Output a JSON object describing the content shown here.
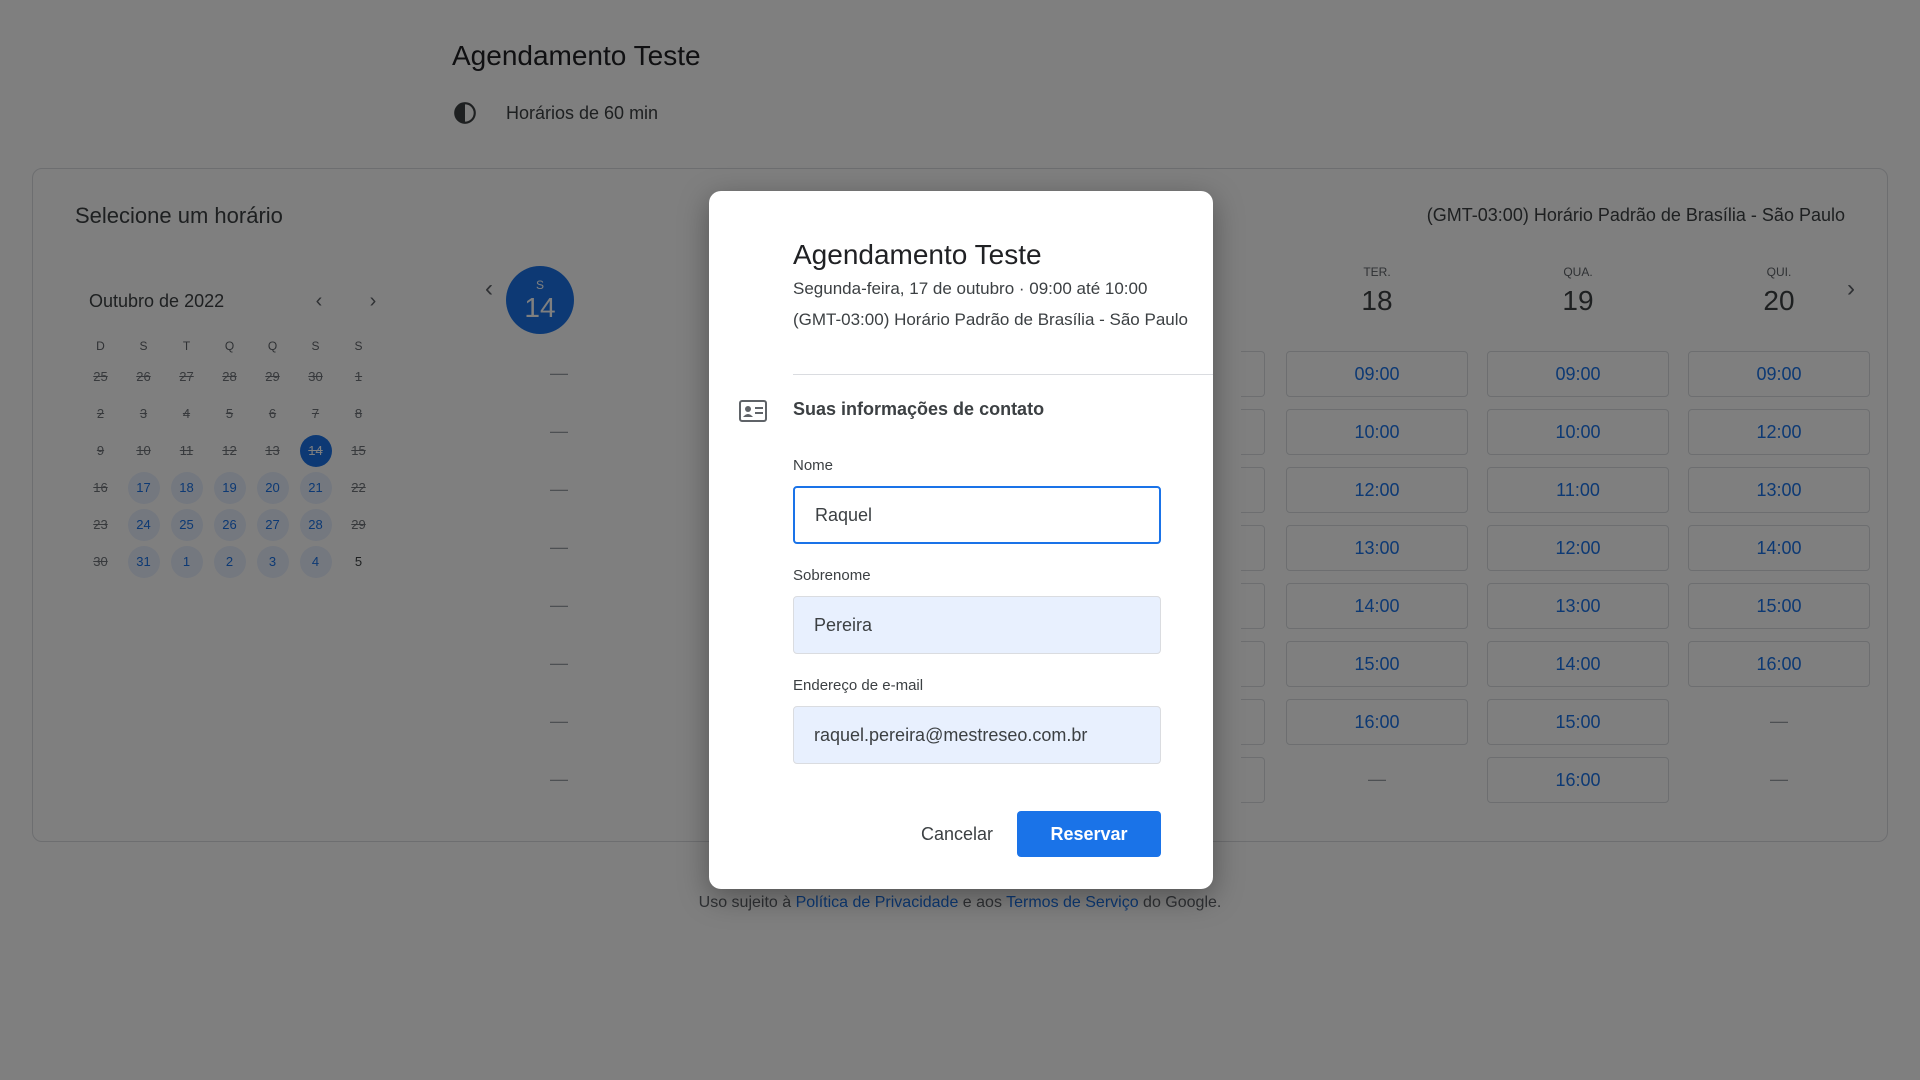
{
  "page": {
    "title": "Agendamento Teste",
    "duration": "Horários de 60 min",
    "section_title": "Selecione um horário",
    "timezone": "(GMT-03:00) Horário Padrão de Brasília - São Paulo"
  },
  "mini_calendar": {
    "month": "Outubro de 2022",
    "prev": "‹",
    "next": "›",
    "weekdays": [
      "D",
      "S",
      "T",
      "Q",
      "Q",
      "S",
      "S"
    ],
    "days": [
      {
        "n": "25",
        "s": "past"
      },
      {
        "n": "26",
        "s": "past"
      },
      {
        "n": "27",
        "s": "past"
      },
      {
        "n": "28",
        "s": "past"
      },
      {
        "n": "29",
        "s": "past"
      },
      {
        "n": "30",
        "s": "past"
      },
      {
        "n": "1",
        "s": "past"
      },
      {
        "n": "2",
        "s": "past"
      },
      {
        "n": "3",
        "s": "past"
      },
      {
        "n": "4",
        "s": "past"
      },
      {
        "n": "5",
        "s": "past"
      },
      {
        "n": "6",
        "s": "past"
      },
      {
        "n": "7",
        "s": "past"
      },
      {
        "n": "8",
        "s": "past"
      },
      {
        "n": "9",
        "s": "past"
      },
      {
        "n": "10",
        "s": "past"
      },
      {
        "n": "11",
        "s": "past"
      },
      {
        "n": "12",
        "s": "past"
      },
      {
        "n": "13",
        "s": "past"
      },
      {
        "n": "14",
        "s": "sel"
      },
      {
        "n": "15",
        "s": "past"
      },
      {
        "n": "16",
        "s": "past"
      },
      {
        "n": "17",
        "s": "avail"
      },
      {
        "n": "18",
        "s": "avail"
      },
      {
        "n": "19",
        "s": "avail"
      },
      {
        "n": "20",
        "s": "avail"
      },
      {
        "n": "21",
        "s": "avail"
      },
      {
        "n": "22",
        "s": "past"
      },
      {
        "n": "23",
        "s": "past"
      },
      {
        "n": "24",
        "s": "avail"
      },
      {
        "n": "25",
        "s": "avail"
      },
      {
        "n": "26",
        "s": "avail"
      },
      {
        "n": "27",
        "s": "avail"
      },
      {
        "n": "28",
        "s": "avail"
      },
      {
        "n": "29",
        "s": "past"
      },
      {
        "n": "30",
        "s": "past"
      },
      {
        "n": "31",
        "s": "avail"
      },
      {
        "n": "1",
        "s": "avail"
      },
      {
        "n": "2",
        "s": "avail"
      },
      {
        "n": "3",
        "s": "avail"
      },
      {
        "n": "4",
        "s": "avail"
      },
      {
        "n": "5",
        "s": "future"
      }
    ]
  },
  "week": {
    "today": {
      "name": "S",
      "num": "14"
    },
    "monday_placeholders": 8,
    "columns": [
      {
        "name": "TER.",
        "num": "18",
        "slots": [
          "09:00",
          "10:00",
          "12:00",
          "13:00",
          "14:00",
          "15:00",
          "16:00",
          "—"
        ]
      },
      {
        "name": "QUA.",
        "num": "19",
        "slots": [
          "09:00",
          "10:00",
          "11:00",
          "12:00",
          "13:00",
          "14:00",
          "15:00",
          "16:00"
        ]
      },
      {
        "name": "QUI.",
        "num": "20",
        "slots": [
          "09:00",
          "12:00",
          "13:00",
          "14:00",
          "15:00",
          "16:00",
          "—",
          "—"
        ]
      }
    ],
    "hidden_slots": 8
  },
  "footer": {
    "prefix": "Uso sujeito à ",
    "privacy": "Política de Privacidade",
    "middle": " e aos ",
    "terms": "Termos de Serviço",
    "suffix": " do Google."
  },
  "dialog": {
    "title": "Agendamento Teste",
    "when": "Segunda-feira, 17 de outubro · 09:00 até 10:00",
    "timezone": "(GMT-03:00) Horário Padrão de Brasília - São Paulo",
    "contact_title": "Suas informações de contato",
    "first_name_label": "Nome",
    "first_name_value": "Raquel",
    "last_name_label": "Sobrenome",
    "last_name_value": "Pereira",
    "email_label": "Endereço de e-mail",
    "email_value": "raquel.pereira@mestreseo.com.br",
    "cancel_label": "Cancelar",
    "reserve_label": "Reservar"
  },
  "colors": {
    "accent": "#1a73e8",
    "overlay": "rgba(0,0,0,0.5)"
  }
}
